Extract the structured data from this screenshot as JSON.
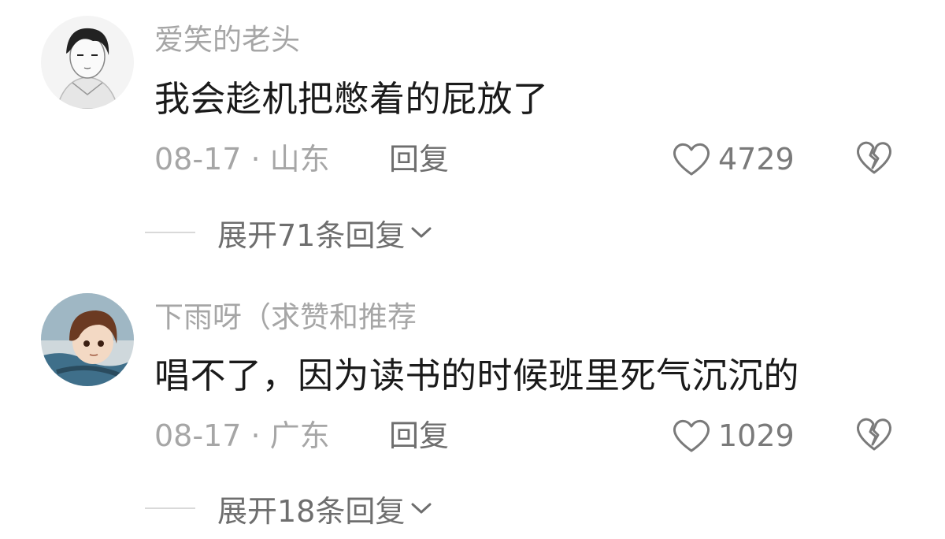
{
  "comments": [
    {
      "username": "爱笑的老头",
      "text": "我会趁机把憋着的屁放了",
      "meta": "08-17 · 山东",
      "reply_label": "回复",
      "likes": "4729",
      "expand_label": "展开71条回复"
    },
    {
      "username": "下雨呀（求赞和推荐",
      "text": "唱不了，因为读书的时候班里死气沉沉的",
      "meta": "08-17 · 广东",
      "reply_label": "回复",
      "likes": "1029",
      "expand_label": "展开18条回复"
    }
  ],
  "icons": {
    "like": "heart-outline-icon",
    "dislike": "broken-heart-icon",
    "expand": "chevron-down-icon"
  },
  "colors": {
    "username": "#a6a6a6",
    "text": "#1a1a1a",
    "meta": "#a6a6a6",
    "action": "#6e6e6e"
  }
}
